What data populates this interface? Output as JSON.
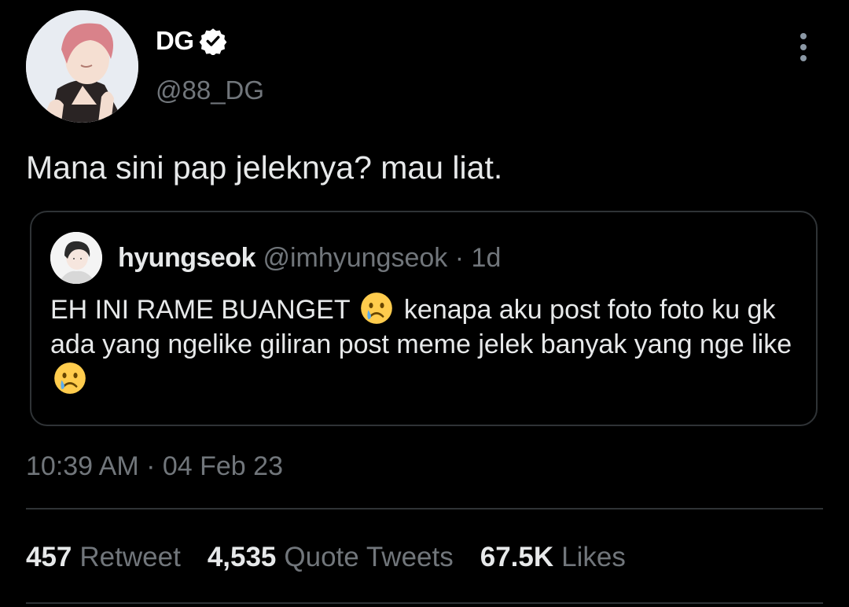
{
  "author": {
    "display_name": "DG",
    "handle": "@88_DG",
    "verified": true
  },
  "tweet": {
    "text": "Mana sini pap jeleknya? mau liat."
  },
  "quoted_tweet": {
    "display_name": "hyungseok",
    "handle": "@imhyungseok",
    "separator": "·",
    "time": "1d",
    "text_part_1": "EH INI RAME BUANGET",
    "text_part_2": "kenapa aku post foto foto ku gk ada yang ngelike giliran post meme jelek banyak yang nge like",
    "emoji": "crying-face"
  },
  "timestamp": "10:39 AM · 04 Feb 23",
  "stats": [
    {
      "count": "457",
      "label": "Retweet"
    },
    {
      "count": "4,535",
      "label": "Quote Tweets"
    },
    {
      "count": "67.5K",
      "label": "Likes"
    }
  ],
  "icons": {
    "verified": "verified-badge-icon",
    "more": "more-vertical-icon"
  },
  "colors": {
    "background": "#000000",
    "text_primary": "#e7e9ea",
    "text_secondary": "#71767b",
    "border": "#2f3336"
  }
}
